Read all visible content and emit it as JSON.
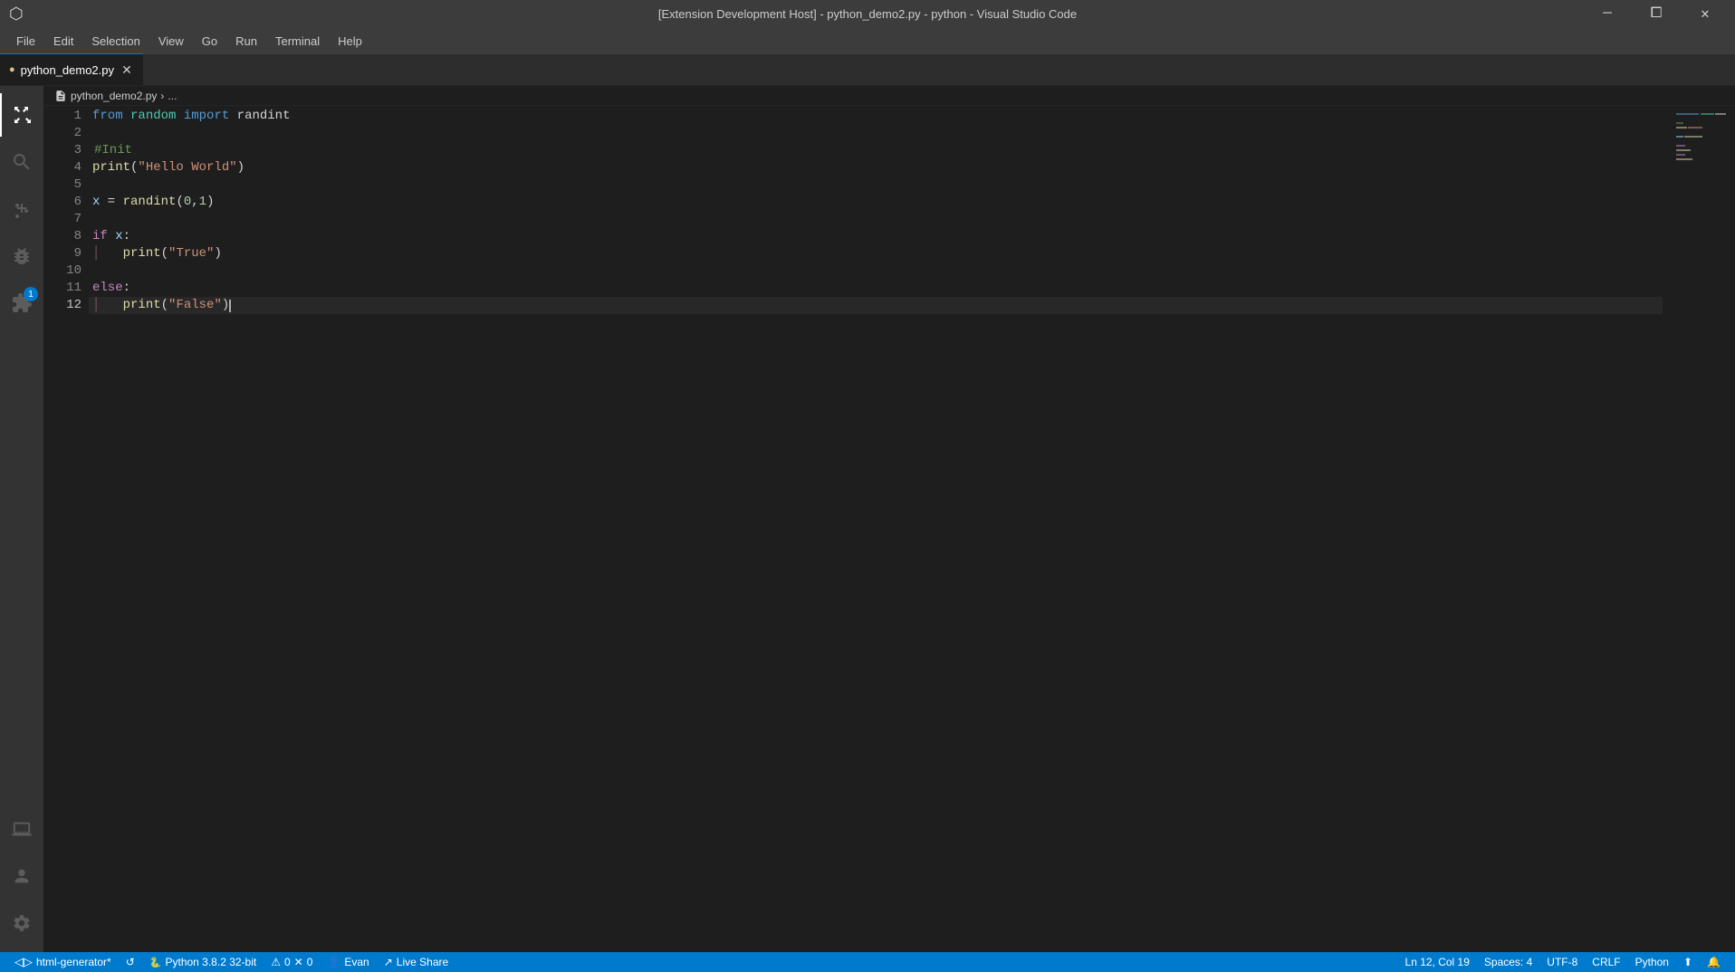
{
  "window": {
    "title": "[Extension Development Host] - python_demo2.py - python - Visual Studio Code"
  },
  "menu": {
    "items": [
      "File",
      "Edit",
      "Selection",
      "View",
      "Go",
      "Run",
      "Terminal",
      "Help"
    ]
  },
  "tabs": [
    {
      "label": "python_demo2.py",
      "active": true,
      "modified": false
    }
  ],
  "breadcrumb": {
    "path": "python_demo2.py",
    "separator": ">",
    "ellipsis": "..."
  },
  "code": {
    "lines": [
      {
        "num": 1,
        "tokens": [
          {
            "type": "kw",
            "text": "from"
          },
          {
            "type": "plain",
            "text": " "
          },
          {
            "type": "mod",
            "text": "random"
          },
          {
            "type": "plain",
            "text": " "
          },
          {
            "type": "kw",
            "text": "import"
          },
          {
            "type": "plain",
            "text": " "
          },
          {
            "type": "plain",
            "text": "randint"
          }
        ]
      },
      {
        "num": 2,
        "tokens": []
      },
      {
        "num": 3,
        "tokens": [
          {
            "type": "cmt",
            "text": "#Init"
          }
        ]
      },
      {
        "num": 4,
        "tokens": [
          {
            "type": "fn",
            "text": "print"
          },
          {
            "type": "plain",
            "text": "("
          },
          {
            "type": "str",
            "text": "\"Hello World\""
          },
          {
            "type": "plain",
            "text": ")"
          }
        ]
      },
      {
        "num": 5,
        "tokens": []
      },
      {
        "num": 6,
        "tokens": [
          {
            "type": "var",
            "text": "x"
          },
          {
            "type": "plain",
            "text": " = "
          },
          {
            "type": "fn",
            "text": "randint"
          },
          {
            "type": "plain",
            "text": "("
          },
          {
            "type": "num",
            "text": "0"
          },
          {
            "type": "plain",
            "text": ","
          },
          {
            "type": "num",
            "text": "1"
          },
          {
            "type": "plain",
            "text": ")"
          }
        ]
      },
      {
        "num": 7,
        "tokens": []
      },
      {
        "num": 8,
        "tokens": [
          {
            "type": "kw-ctrl",
            "text": "if"
          },
          {
            "type": "plain",
            "text": " "
          },
          {
            "type": "var",
            "text": "x"
          },
          {
            "type": "plain",
            "text": ":"
          }
        ]
      },
      {
        "num": 9,
        "tokens": [
          {
            "type": "plain",
            "text": "    "
          },
          {
            "type": "fn",
            "text": "print"
          },
          {
            "type": "plain",
            "text": "("
          },
          {
            "type": "str",
            "text": "\"True\""
          },
          {
            "type": "plain",
            "text": ")"
          }
        ]
      },
      {
        "num": 10,
        "tokens": []
      },
      {
        "num": 11,
        "tokens": [
          {
            "type": "kw-ctrl",
            "text": "else"
          },
          {
            "type": "plain",
            "text": ":"
          }
        ]
      },
      {
        "num": 12,
        "tokens": [
          {
            "type": "plain",
            "text": "    "
          },
          {
            "type": "fn",
            "text": "print"
          },
          {
            "type": "plain",
            "text": "("
          },
          {
            "type": "str",
            "text": "\"False\""
          },
          {
            "type": "plain",
            "text": ")"
          }
        ],
        "active": true
      }
    ]
  },
  "activity_bar": {
    "icons": [
      {
        "name": "explorer",
        "symbol": "⬜",
        "active": true
      },
      {
        "name": "search",
        "symbol": "🔍"
      },
      {
        "name": "source-control",
        "symbol": "⑂",
        "badge": null
      },
      {
        "name": "debug",
        "symbol": "▷"
      },
      {
        "name": "extensions",
        "symbol": "⧉",
        "badge": "1"
      }
    ],
    "bottom": [
      {
        "name": "remote-explorer",
        "symbol": "🖥"
      },
      {
        "name": "account",
        "symbol": "👤"
      },
      {
        "name": "settings",
        "symbol": "⚙"
      }
    ]
  },
  "status_bar": {
    "left": [
      {
        "id": "remote",
        "icon": "◁▷",
        "label": "html-generator*"
      },
      {
        "id": "sync",
        "icon": "↺",
        "label": ""
      },
      {
        "id": "python",
        "label": "Python 3.8.2 32-bit"
      },
      {
        "id": "errors",
        "icon": "⚠",
        "label": "0",
        "icon2": "✕",
        "label2": "0"
      },
      {
        "id": "liveshare",
        "icon": "👤",
        "label": "Evan"
      },
      {
        "id": "liveshare2",
        "icon": "↗",
        "label": "Live Share"
      }
    ],
    "right": [
      {
        "id": "position",
        "label": "Ln 12, Col 19"
      },
      {
        "id": "spaces",
        "label": "Spaces: 4"
      },
      {
        "id": "encoding",
        "label": "UTF-8"
      },
      {
        "id": "eol",
        "label": "CRLF"
      },
      {
        "id": "language",
        "label": "Python"
      },
      {
        "id": "feedback",
        "icon": "☺",
        "label": ""
      },
      {
        "id": "bell",
        "icon": "🔔",
        "label": ""
      }
    ]
  }
}
